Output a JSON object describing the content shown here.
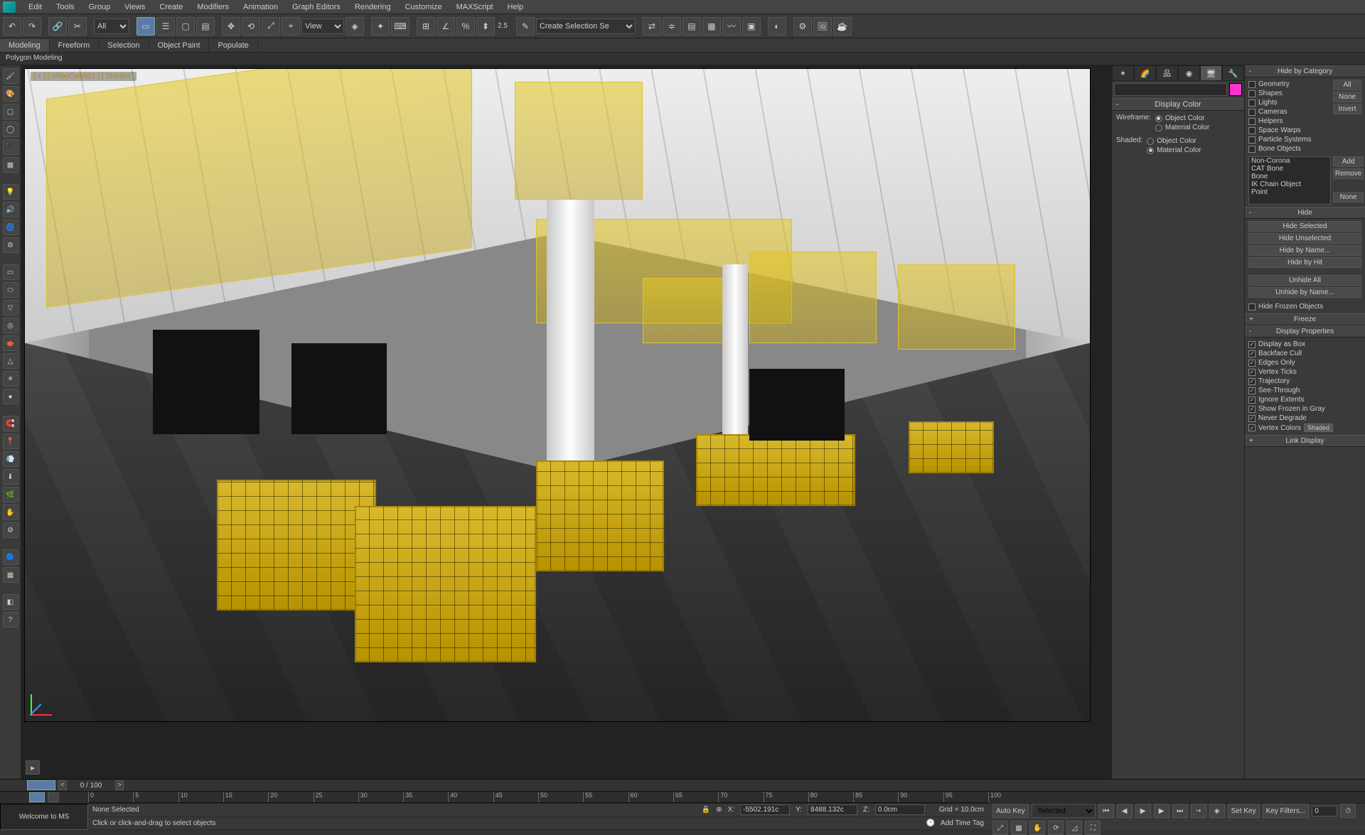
{
  "menu": [
    "Edit",
    "Tools",
    "Group",
    "Views",
    "Create",
    "Modifiers",
    "Animation",
    "Graph Editors",
    "Rendering",
    "Customize",
    "MAXScript",
    "Help"
  ],
  "toolbar": {
    "select_set_all": "All",
    "view_dropdown": "View",
    "degree_label": "2.5",
    "create_sel_set": "Create Selection Se"
  },
  "ribbon_tabs": [
    "Modeling",
    "Freeform",
    "Selection",
    "Object Paint",
    "Populate"
  ],
  "ribbon_sub": "Polygon Modeling",
  "viewport": {
    "label": "[ + ] [ VRayCam001 ] [ Shaded ]"
  },
  "cmdpanel": {
    "name_value": "",
    "roll_display_color": "Display Color",
    "wireframe": "Wireframe:",
    "shaded": "Shaded:",
    "opt_object_color": "Object Color",
    "opt_material_color": "Material Color"
  },
  "rp": {
    "hide_by_cat": "Hide by Category",
    "cats": [
      "Geometry",
      "Shapes",
      "Lights",
      "Cameras",
      "Helpers",
      "Space Warps",
      "Particle Systems",
      "Bone Objects"
    ],
    "catbtns": {
      "all": "All",
      "none": "None",
      "invert": "Invert"
    },
    "listitems": [
      "Non-Corona",
      "CAT Bone",
      "Bone",
      "IK Chain Object",
      "Point"
    ],
    "listbtns": {
      "add": "Add",
      "remove": "Remove",
      "none": "None"
    },
    "hide": "Hide",
    "hide_selected": "Hide Selected",
    "hide_unselected": "Hide Unselected",
    "hide_by_name": "Hide by Name...",
    "hide_by_hit": "Hide by Hit",
    "unhide_all": "Unhide All",
    "unhide_by_name": "Unhide by Name...",
    "hide_frozen": "Hide Frozen Objects",
    "freeze": "Freeze",
    "disp_props": "Display Properties",
    "props": [
      "Display as Box",
      "Backface Cull",
      "Edges Only",
      "Vertex Ticks",
      "Trajectory",
      "See-Through",
      "Ignore Extents",
      "Show Frozen in Gray",
      "Never Degrade",
      "Vertex Colors"
    ],
    "shaded_btn": "Shaded",
    "link_display": "Link Display"
  },
  "timetrack": {
    "frame_label": "0 / 100"
  },
  "timeline_ticks": [
    "0",
    "5",
    "10",
    "15",
    "20",
    "25",
    "30",
    "35",
    "40",
    "45",
    "50",
    "55",
    "60",
    "65",
    "70",
    "75",
    "80",
    "85",
    "90",
    "95",
    "100"
  ],
  "status": {
    "welcome": "Welcome to MS",
    "none_selected": "None Selected",
    "prompt": "Click or click-and-drag to select objects",
    "x": "-5502.191c",
    "y": "8488.132c",
    "z": "0.0cm",
    "grid": "Grid = 10.0cm",
    "add_time_tag": "Add Time Tag",
    "auto_key": "Auto Key",
    "set_key": "Set Key",
    "key_mode": "Selected",
    "key_filters": "Key Filters...",
    "frame_current": "0"
  }
}
